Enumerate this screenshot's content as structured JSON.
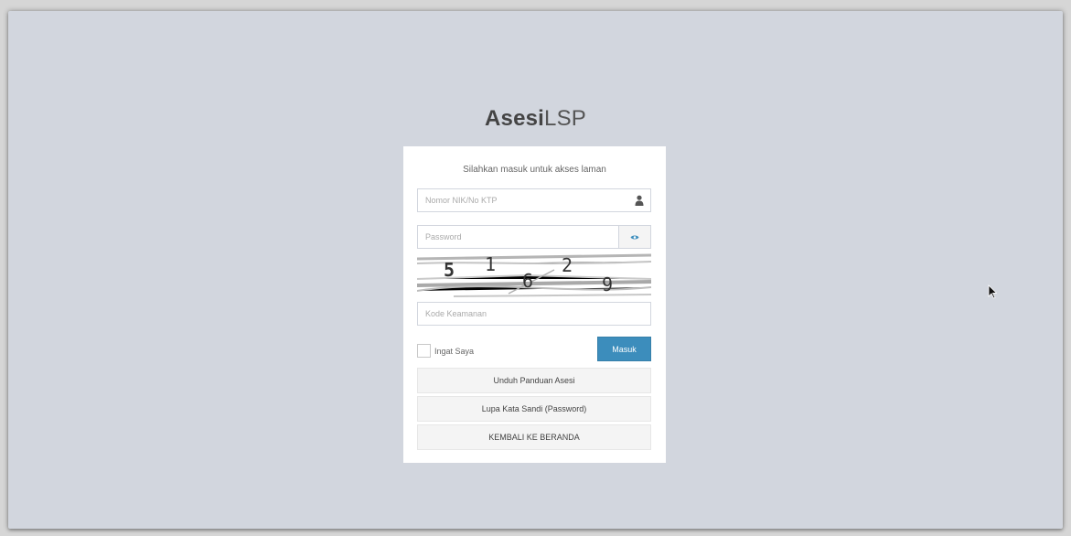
{
  "logo": {
    "bold": "Asesi",
    "light": "LSP"
  },
  "login": {
    "message": "Silahkan masuk untuk akses laman",
    "username_placeholder": "Nomor NIK/No KTP",
    "password_placeholder": "Password",
    "captcha_digits": [
      "5",
      "1",
      "6",
      "2",
      "9"
    ],
    "code_placeholder": "Kode Keamanan",
    "remember_label": "Ingat Saya",
    "submit_label": "Masuk"
  },
  "links": {
    "guide": "Unduh Panduan Asesi",
    "forgot": "Lupa Kata Sandi (Password)",
    "home": "KEMBALI KE BERANDA"
  },
  "icons": {
    "user": "user-icon",
    "password_toggle": "eye-icon",
    "cursor": "mouse-pointer-icon"
  },
  "colors": {
    "page_background": "#d2d6de",
    "primary_button": "#3c8dbc"
  }
}
